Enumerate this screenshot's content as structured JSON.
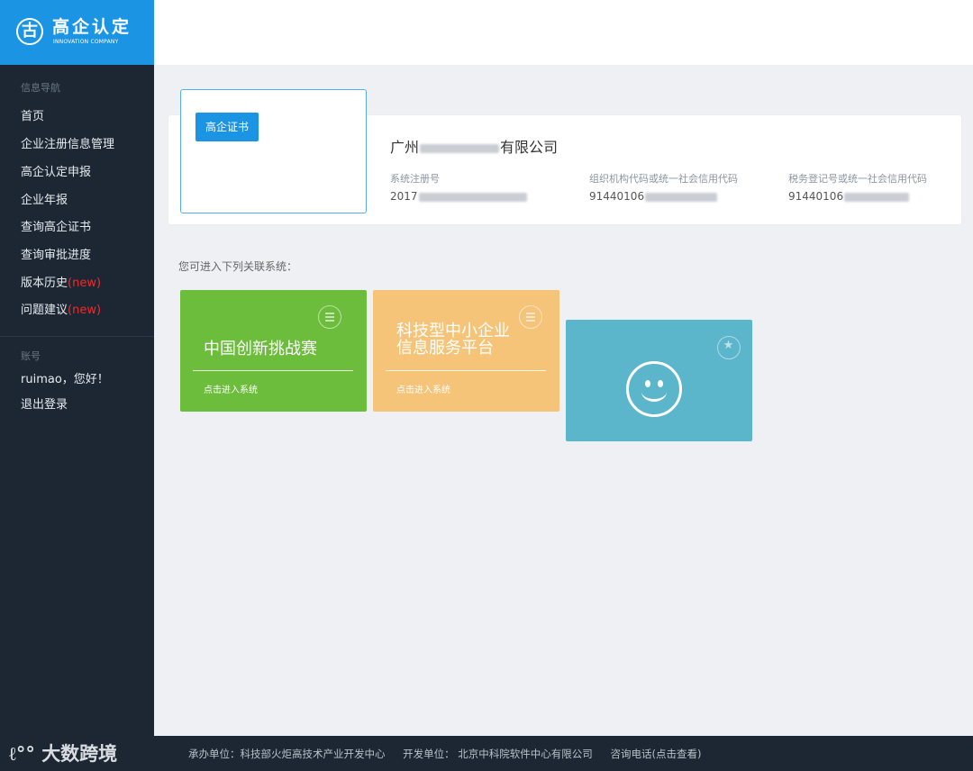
{
  "logo": {
    "glyph": "古",
    "title": "高企认定",
    "subtitle": "INNOVATION COMPANY"
  },
  "sidebar": {
    "nav_section": "信息导航",
    "items": [
      {
        "label": "首页",
        "new": ""
      },
      {
        "label": "企业注册信息管理",
        "new": ""
      },
      {
        "label": "高企认定申报",
        "new": ""
      },
      {
        "label": "企业年报",
        "new": ""
      },
      {
        "label": "查询高企证书",
        "new": ""
      },
      {
        "label": "查询审批进度",
        "new": ""
      },
      {
        "label": "版本历史",
        "new": "(new)"
      },
      {
        "label": "问题建议",
        "new": "(new)"
      }
    ],
    "account_section": "账号",
    "greeting": "ruimao，您好！",
    "logout": "退出登录"
  },
  "company": {
    "cert_button": "高企证书",
    "name_prefix": "广州",
    "name_suffix": "有限公司",
    "fields": [
      {
        "label": "系统注册号",
        "value": "2017"
      },
      {
        "label": "组织机构代码或统一社会信用代码",
        "value": "91440106"
      },
      {
        "label": "税务登记号或统一社会信用代码",
        "value": "91440106"
      }
    ]
  },
  "systems": {
    "intro": "您可进入下列关联系统：",
    "tiles": [
      {
        "title_line1": "中国创新挑战赛",
        "title_line2": "",
        "link": "点击进入系统",
        "color": "#6cbd3b"
      },
      {
        "title_line1": "科技型中小企业",
        "title_line2": "信息服务平台",
        "link": "点击进入系统",
        "color": "#f6c479"
      },
      {
        "title_line1": "",
        "title_line2": "",
        "link": "",
        "color": "#5cb6cb"
      }
    ]
  },
  "footer": {
    "organizer": "承办单位：科技部火炬高技术产业开发中心",
    "developer": "开发单位： 北京中科院软件中心有限公司",
    "hotline": "咨询电话(点击查看)"
  },
  "watermark": "大数跨境",
  "colors": {
    "primary": "#1b94e3",
    "sidebar": "#1d2733",
    "new_badge": "#ee2b2b"
  }
}
